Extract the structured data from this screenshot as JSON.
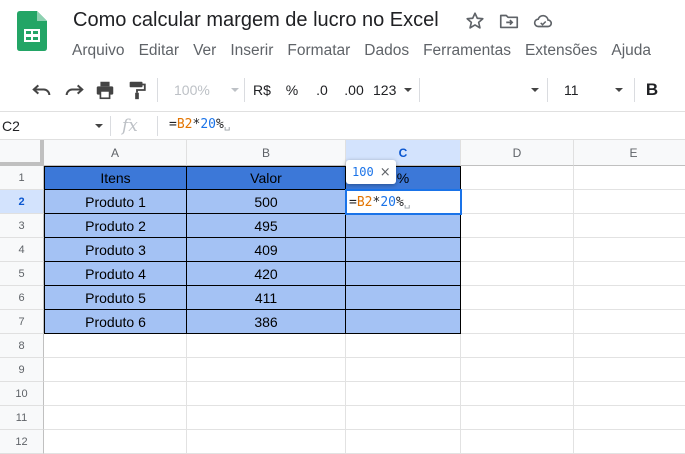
{
  "window": {
    "title": "Como calcular margem de lucro no Excel"
  },
  "menu": [
    "Arquivo",
    "Editar",
    "Ver",
    "Inserir",
    "Formatar",
    "Dados",
    "Ferramentas",
    "Extensões",
    "Ajuda"
  ],
  "toolbar": {
    "zoom": "100%",
    "currency_label": "R$",
    "percent_label": "%",
    "decrease_decimals_label": ".0",
    "increase_decimals_label": ".00",
    "number_format_label": "123",
    "font_size": "11",
    "bold_label": "B"
  },
  "formula_bar": {
    "cell_ref": "C2",
    "fx_label": "fx",
    "formula_prefix": "=",
    "formula_ref": "B2",
    "formula_op": "*",
    "formula_num": "20",
    "formula_pct": "%"
  },
  "sheet": {
    "columns": [
      "A",
      "B",
      "C",
      "D",
      "E"
    ],
    "rows": [
      "1",
      "2",
      "3",
      "4",
      "5",
      "6",
      "7",
      "8",
      "9",
      "10",
      "11",
      "12"
    ],
    "header_row": [
      "Itens",
      "Valor",
      "%"
    ],
    "data_rows": [
      [
        "Produto 1",
        "500",
        ""
      ],
      [
        "Produto 2",
        "495",
        ""
      ],
      [
        "Produto 3",
        "409",
        ""
      ],
      [
        "Produto 4",
        "420",
        ""
      ],
      [
        "Produto 5",
        "411",
        ""
      ],
      [
        "Produto 6",
        "386",
        ""
      ]
    ],
    "active_cell_formula": {
      "prefix": "=",
      "ref": "B2",
      "op": "*",
      "num": "20",
      "pct": "%"
    },
    "preview_value": "100",
    "preview_close": "×"
  },
  "colors": {
    "header_fill": "#3c78d8",
    "body_fill": "#a4c2f4",
    "accent": "#1a73e8",
    "reference": "#e37400"
  }
}
